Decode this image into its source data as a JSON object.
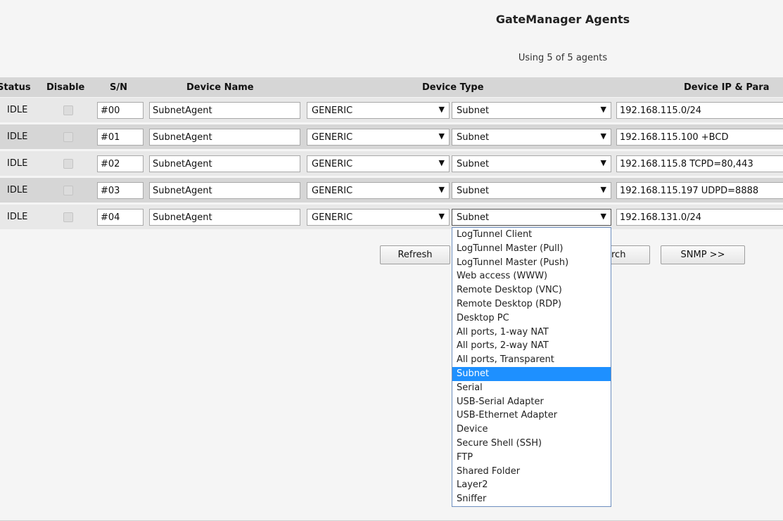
{
  "page": {
    "title": "GateManager Agents",
    "usage": "Using 5 of 5 agents"
  },
  "table": {
    "headers": {
      "status": "Status",
      "disable": "Disable",
      "sn": "S/N",
      "device_name": "Device Name",
      "device_type": "Device Type",
      "device_ip": "Device IP & Para"
    },
    "rows": [
      {
        "status": "IDLE",
        "disabled": false,
        "sn": "#00",
        "name": "SubnetAgent",
        "vendor": "GENERIC",
        "type": "Subnet",
        "ip": "192.168.115.0/24"
      },
      {
        "status": "IDLE",
        "disabled": false,
        "sn": "#01",
        "name": "SubnetAgent",
        "vendor": "GENERIC",
        "type": "Subnet",
        "ip": "192.168.115.100 +BCD"
      },
      {
        "status": "IDLE",
        "disabled": false,
        "sn": "#02",
        "name": "SubnetAgent",
        "vendor": "GENERIC",
        "type": "Subnet",
        "ip": "192.168.115.8 TCPD=80,443"
      },
      {
        "status": "IDLE",
        "disabled": false,
        "sn": "#03",
        "name": "SubnetAgent",
        "vendor": "GENERIC",
        "type": "Subnet",
        "ip": "192.168.115.197 UDPD=8888"
      },
      {
        "status": "IDLE",
        "disabled": false,
        "sn": "#04",
        "name": "SubnetAgent",
        "vendor": "GENERIC",
        "type": "Subnet",
        "ip": "192.168.131.0/24"
      }
    ]
  },
  "buttons": {
    "refresh": "Refresh",
    "search_partial": "rch",
    "snmp": "SNMP >>"
  },
  "dropdown": {
    "options": [
      "LogTunnel Client",
      "LogTunnel Master (Pull)",
      "LogTunnel Master (Push)",
      "Web access (WWW)",
      "Remote Desktop (VNC)",
      "Remote Desktop (RDP)",
      "Desktop PC",
      "All ports, 1-way NAT",
      "All ports, 2-way NAT",
      "All ports, Transparent",
      "Subnet",
      "Serial",
      "USB-Serial Adapter",
      "USB-Ethernet Adapter",
      "Device",
      "Secure Shell (SSH)",
      "FTP",
      "Shared Folder",
      "Layer2",
      "Sniffer"
    ],
    "selected": "Subnet"
  },
  "icons": {
    "dropdown_arrow": "triangle-down-icon"
  },
  "colors": {
    "selection": "#1e90ff"
  }
}
